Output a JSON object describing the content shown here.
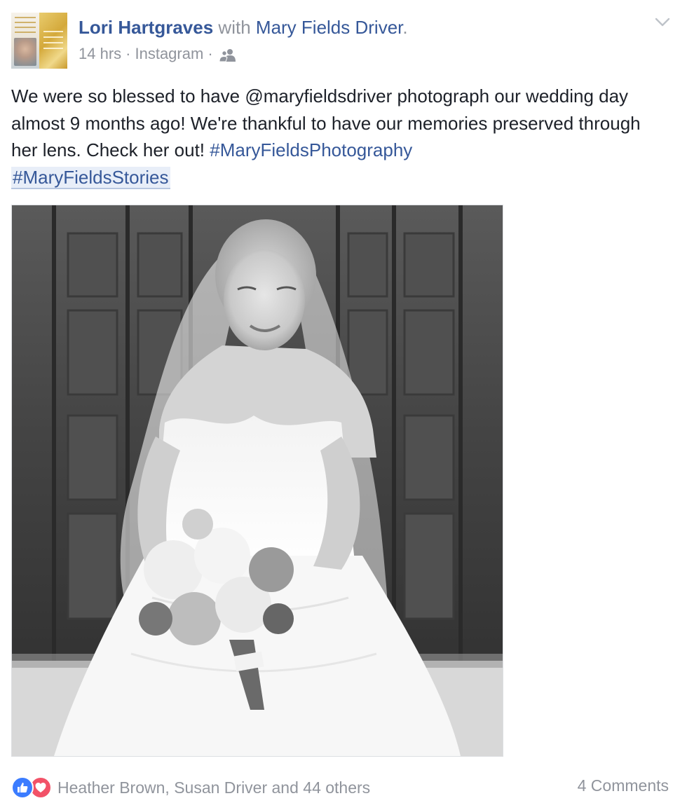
{
  "header": {
    "author": "Lori Hartgraves",
    "with_text": "with",
    "tagged": "Mary Fields Driver",
    "period": ".",
    "time": "14 hrs",
    "separator": "·",
    "source": "Instagram",
    "audience_icon": "friends-icon",
    "menu_icon": "chevron-down-icon"
  },
  "post": {
    "text": "We were so blessed to have @maryfieldsdriver photograph our wedding day almost 9 months ago! We're thankful to have our memories preserved through her lens. Check her out! ",
    "hashtag1": "#MaryFieldsPhotography",
    "hashtag2": "#MaryFieldsStories"
  },
  "footer": {
    "reactions": [
      "like-icon",
      "love-icon"
    ],
    "reactors": "Heather Brown, Susan Driver and 44 others",
    "comments": "4 Comments"
  },
  "colors": {
    "link": "#365899",
    "meta": "#90949c",
    "text": "#1d2129",
    "like": "#3b7cff",
    "love": "#f25268"
  }
}
